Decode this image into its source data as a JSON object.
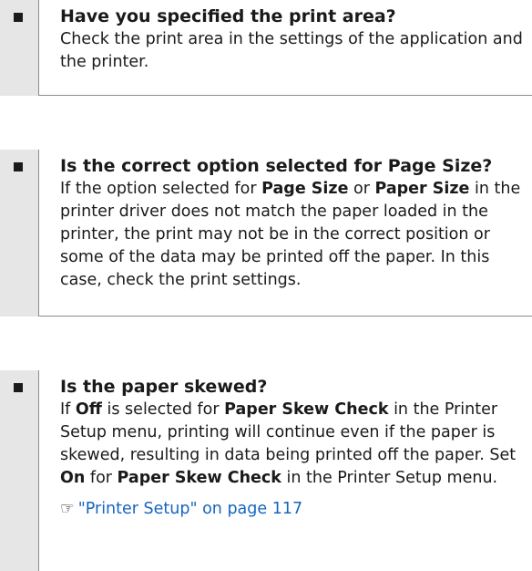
{
  "items": [
    {
      "question": "Have you specified the print area?",
      "answer": "Check the print area in the settings of the application and the printer."
    },
    {
      "question": "Is the correct option selected for Page Size?",
      "answer_parts": [
        "If the option selected for ",
        "Page Size",
        " or ",
        "Paper Size",
        " in the printer driver does not match the paper loaded in the printer, the print may not be in the correct position or some of the data may be printed off the paper. In this case, check the print settings."
      ]
    },
    {
      "question": "Is the paper skewed?",
      "answer_parts": [
        "If ",
        "Off",
        " is selected for ",
        "Paper Skew Check",
        " in the Printer Setup menu, printing will continue even if the paper is skewed, resulting in data being printed off the paper. Set ",
        "On",
        " for ",
        "Paper Skew Check",
        " in the Printer Setup menu."
      ],
      "reference": {
        "icon": "hand-pointer-icon",
        "glyph": "☞",
        "text": "\"Printer Setup\" on page 117"
      }
    }
  ]
}
